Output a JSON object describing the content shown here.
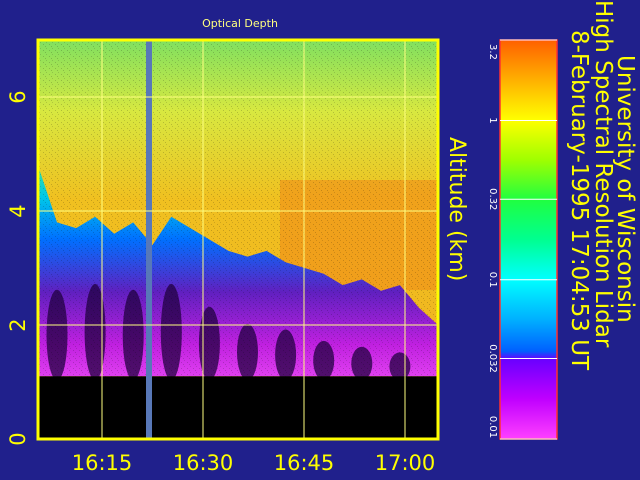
{
  "chart_data": {
    "type": "heatmap",
    "title": "Optical Depth",
    "ylabel": "Altitude (km)",
    "x_tick_labels": [
      "16:15",
      "16:30",
      "16:45",
      "17:00"
    ],
    "y_tick_labels": [
      "0",
      "2",
      "4",
      "6"
    ],
    "ylim": [
      0,
      7
    ],
    "grid": true,
    "colorbar": {
      "scale": "log",
      "range": [
        0.01,
        3.2
      ],
      "tick_labels": [
        "3.2",
        "1",
        "0.32",
        "0.1",
        "0.032",
        "0.01"
      ]
    },
    "cloud_base_km": 1.1,
    "cloud_top_profile_km": [
      4.8,
      3.8,
      3.7,
      3.9,
      3.6,
      3.8,
      3.4,
      3.9,
      3.7,
      3.5,
      3.3,
      3.2,
      3.3,
      3.1,
      3.0,
      2.9,
      2.7,
      2.8,
      2.6,
      2.7,
      2.3,
      2.0
    ]
  },
  "side_text": {
    "line1": "University of Wisconsin",
    "line2": "High Spectral Resolution Lidar",
    "line3": "8-February-1995 17:04:53 UT"
  },
  "colors": {
    "background": "#20208c",
    "frame": "#ffff00",
    "below_cloud": "#000000"
  }
}
